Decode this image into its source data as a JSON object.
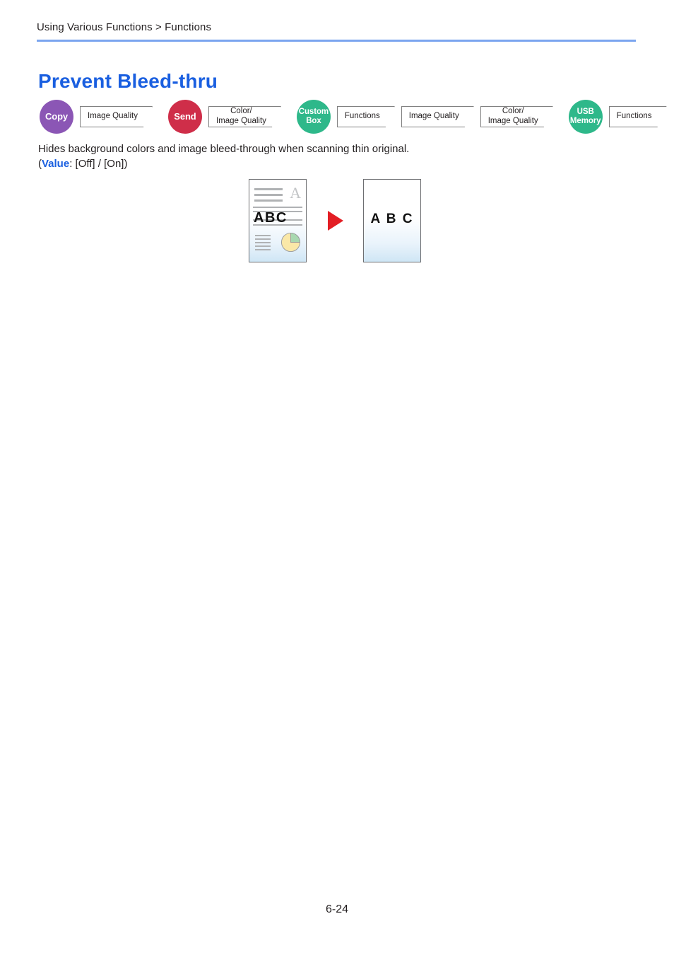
{
  "header": {
    "breadcrumb": "Using Various Functions > Functions",
    "rule_color": "#7ba5ef"
  },
  "title": "Prevent Bleed-thru",
  "title_color": "#1a5fe0",
  "badges": [
    {
      "mode": "Copy",
      "mode_lines": [
        "Copy"
      ],
      "color": "#8b56b5",
      "chips": [
        {
          "lines": [
            "Image Quality"
          ]
        }
      ]
    },
    {
      "mode": "Send",
      "mode_lines": [
        "Send"
      ],
      "color": "#cf2e49",
      "chips": [
        {
          "lines": [
            "Color/",
            "Image Quality"
          ]
        }
      ]
    },
    {
      "mode": "Custom Box",
      "mode_lines": [
        "Custom",
        "Box"
      ],
      "color": "#2eb88a",
      "chips": [
        {
          "lines": [
            "Functions"
          ]
        },
        {
          "lines": [
            "Image Quality"
          ]
        },
        {
          "lines": [
            "Color/",
            "Image Quality"
          ]
        }
      ]
    },
    {
      "mode": "USB Memory",
      "mode_lines": [
        "USB",
        "Memory"
      ],
      "color": "#2eb88a",
      "chips": [
        {
          "lines": [
            "Functions"
          ]
        }
      ]
    }
  ],
  "description": {
    "line1": "Hides background colors and image bleed-through when scanning thin original.",
    "line2_open": "(",
    "line2_keyword": "Value",
    "line2_rest": ": [Off] / [On])"
  },
  "illustration": {
    "source_page": {
      "text": "ABC",
      "faded_letter": "A",
      "pie_main_color": "#fae8a8",
      "pie_wedge_color": "#a8d8b0"
    },
    "arrow": "triangle-right-icon",
    "arrow_color": "#e31e24",
    "result_page": {
      "text": "A B C"
    }
  },
  "footer": {
    "page_number": "6-24"
  }
}
